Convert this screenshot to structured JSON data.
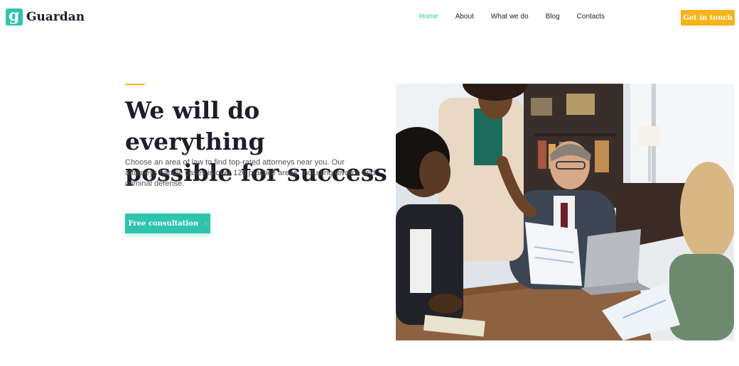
{
  "brand": {
    "icon_letter": "g",
    "name": "Guardan",
    "icon": "logo-g-icon"
  },
  "nav": {
    "items": [
      {
        "label": "Home",
        "active": true
      },
      {
        "label": "About",
        "active": false
      },
      {
        "label": "What we do",
        "active": false
      },
      {
        "label": "Blog",
        "active": false
      },
      {
        "label": "Contacts",
        "active": false
      }
    ],
    "cta_label": "Get in touch"
  },
  "hero": {
    "title_line1": "We will do everything",
    "title_line2": "possible for success",
    "description": "Choose an area of law to find top-rated attorneys near you. Our attorneys handle cases in over 120 practice areas, including divorce and criminal defense.",
    "button_label": "Free consultation",
    "button_icon": "chevron-right-icon"
  },
  "colors": {
    "accent": "#2ec4b0",
    "highlight": "#f8b318",
    "heading": "#1d1d2b"
  }
}
